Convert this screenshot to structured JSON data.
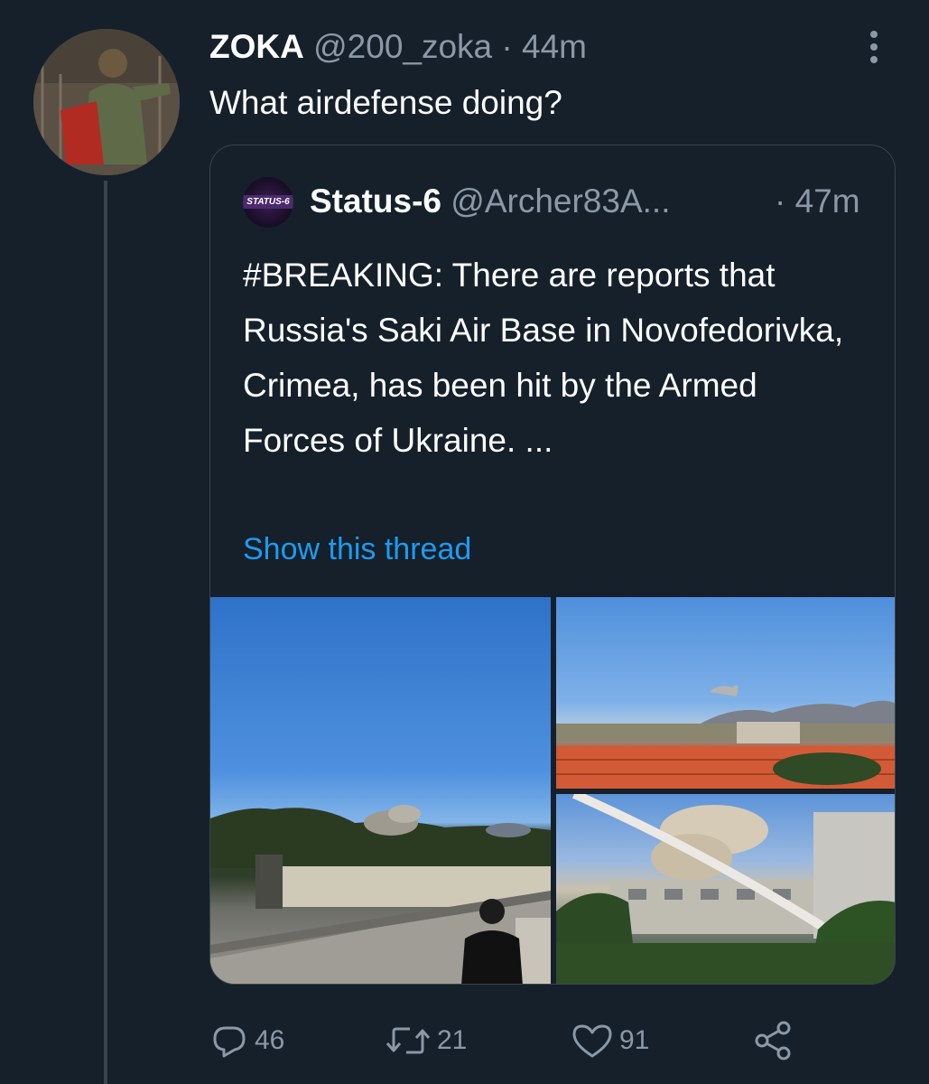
{
  "tweet": {
    "display_name": "ZOKA",
    "handle": "@200_zoka",
    "separator": "·",
    "time": "44m",
    "text": "What airdefense doing?"
  },
  "quoted_tweet": {
    "avatar_label": "STATUS-6",
    "display_name": "Status-6",
    "handle": "@Archer83A...",
    "separator": "·",
    "time": "47m",
    "text": "#BREAKING: There are reports that Russia's Saki Air Base in Novofedorivka, Crimea, has been hit by the Armed Forces of Ukraine. ...",
    "show_thread": "Show this thread"
  },
  "actions": {
    "replies": "46",
    "retweets": "21",
    "likes": "91"
  },
  "icons": {
    "more": "more-vertical-icon",
    "reply": "reply-icon",
    "retweet": "retweet-icon",
    "like": "heart-icon",
    "share": "share-icon"
  },
  "colors": {
    "background": "#15202b",
    "muted_text": "#8b98a5",
    "link": "#1d9bf0",
    "border": "#38444d"
  }
}
